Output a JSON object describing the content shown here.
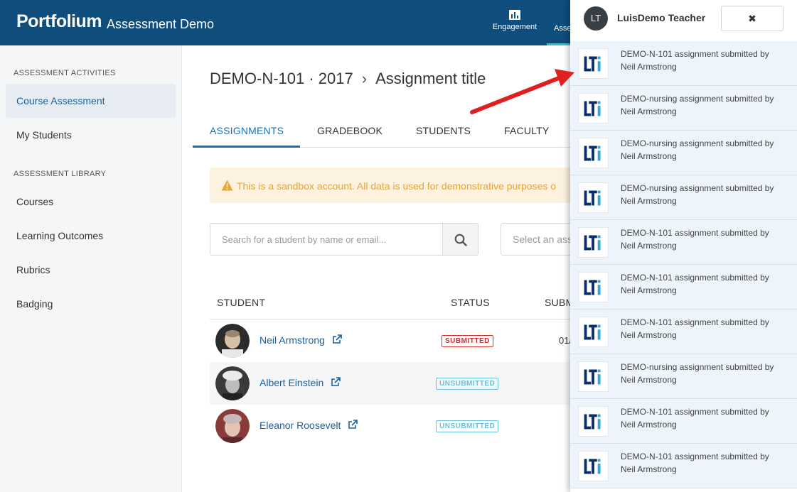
{
  "header": {
    "logo": "Portfolium",
    "app_title": "Assessment Demo",
    "nav": [
      {
        "label": "Engagement",
        "icon": "bar-chart-icon"
      },
      {
        "label": "Asse"
      }
    ],
    "accent": "#35c3c0",
    "bg_color": "#0e4d7c"
  },
  "sidebar": {
    "section1": "ASSESSMENT ACTIVITIES",
    "items1": [
      {
        "label": "Course Assessment",
        "active": true
      },
      {
        "label": "My Students"
      }
    ],
    "section2": "ASSESSMENT LIBRARY",
    "items2": [
      {
        "label": "Courses"
      },
      {
        "label": "Learning Outcomes"
      },
      {
        "label": "Rubrics"
      },
      {
        "label": "Badging"
      }
    ]
  },
  "main": {
    "breadcrumb": {
      "course": "DEMO-N-101 · 2017",
      "separator": "›",
      "page": "Assignment title"
    },
    "tabs": [
      "ASSIGNMENTS",
      "GRADEBOOK",
      "STUDENTS",
      "FACULTY"
    ],
    "active_tab": "ASSIGNMENTS",
    "alert": "This is a sandbox account. All data is used for demonstrative purposes o",
    "search_placeholder": "Search for a student by name or email...",
    "select_placeholder": "Select an ass",
    "table": {
      "headers": [
        "STUDENT",
        "STATUS",
        "SUBM"
      ],
      "rows": [
        {
          "name": "Neil Armstrong",
          "status": "SUBMITTED",
          "date": "01/"
        },
        {
          "name": "Albert Einstein",
          "status": "UNSUBMITTED",
          "date": ""
        },
        {
          "name": "Eleanor Roosevelt",
          "status": "UNSUBMITTED",
          "date": ""
        }
      ]
    }
  },
  "panel": {
    "user_initials": "LT",
    "user_name": "LuisDemo Teacher",
    "close_label": "✖",
    "notifications": [
      {
        "title": "DEMO-N-101 assignment submitted by",
        "who": "Neil Armstrong"
      },
      {
        "title": "DEMO-nursing assignment submitted by",
        "who": "Neil Armstrong"
      },
      {
        "title": "DEMO-nursing assignment submitted by",
        "who": "Neil Armstrong"
      },
      {
        "title": "DEMO-nursing assignment submitted by",
        "who": "Neil Armstrong"
      },
      {
        "title": "DEMO-N-101 assignment submitted by",
        "who": "Neil Armstrong"
      },
      {
        "title": "DEMO-N-101 assignment submitted by",
        "who": "Neil Armstrong"
      },
      {
        "title": "DEMO-N-101 assignment submitted by",
        "who": "Neil Armstrong"
      },
      {
        "title": "DEMO-nursing assignment submitted by",
        "who": "Neil Armstrong"
      },
      {
        "title": "DEMO-N-101 assignment submitted by",
        "who": "Neil Armstrong"
      },
      {
        "title": "DEMO-N-101 assignment submitted by",
        "who": "Neil Armstrong"
      }
    ]
  }
}
